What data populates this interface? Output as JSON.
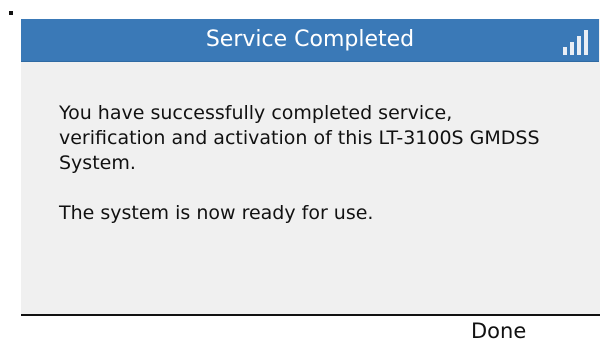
{
  "dialog": {
    "title": "Service Completed",
    "signal_icon": "signal-bars-icon",
    "message": {
      "paragraph_1": "You have successfully completed service, verification and activation of this LT-3100S GMDSS System.",
      "paragraph_2": "The system is now ready for use."
    },
    "softkey_done": "Done"
  },
  "colors": {
    "title_bar": "#3a79b7",
    "panel_background": "#f0f0f0",
    "title_text": "#ffffff",
    "body_text": "#111111"
  }
}
